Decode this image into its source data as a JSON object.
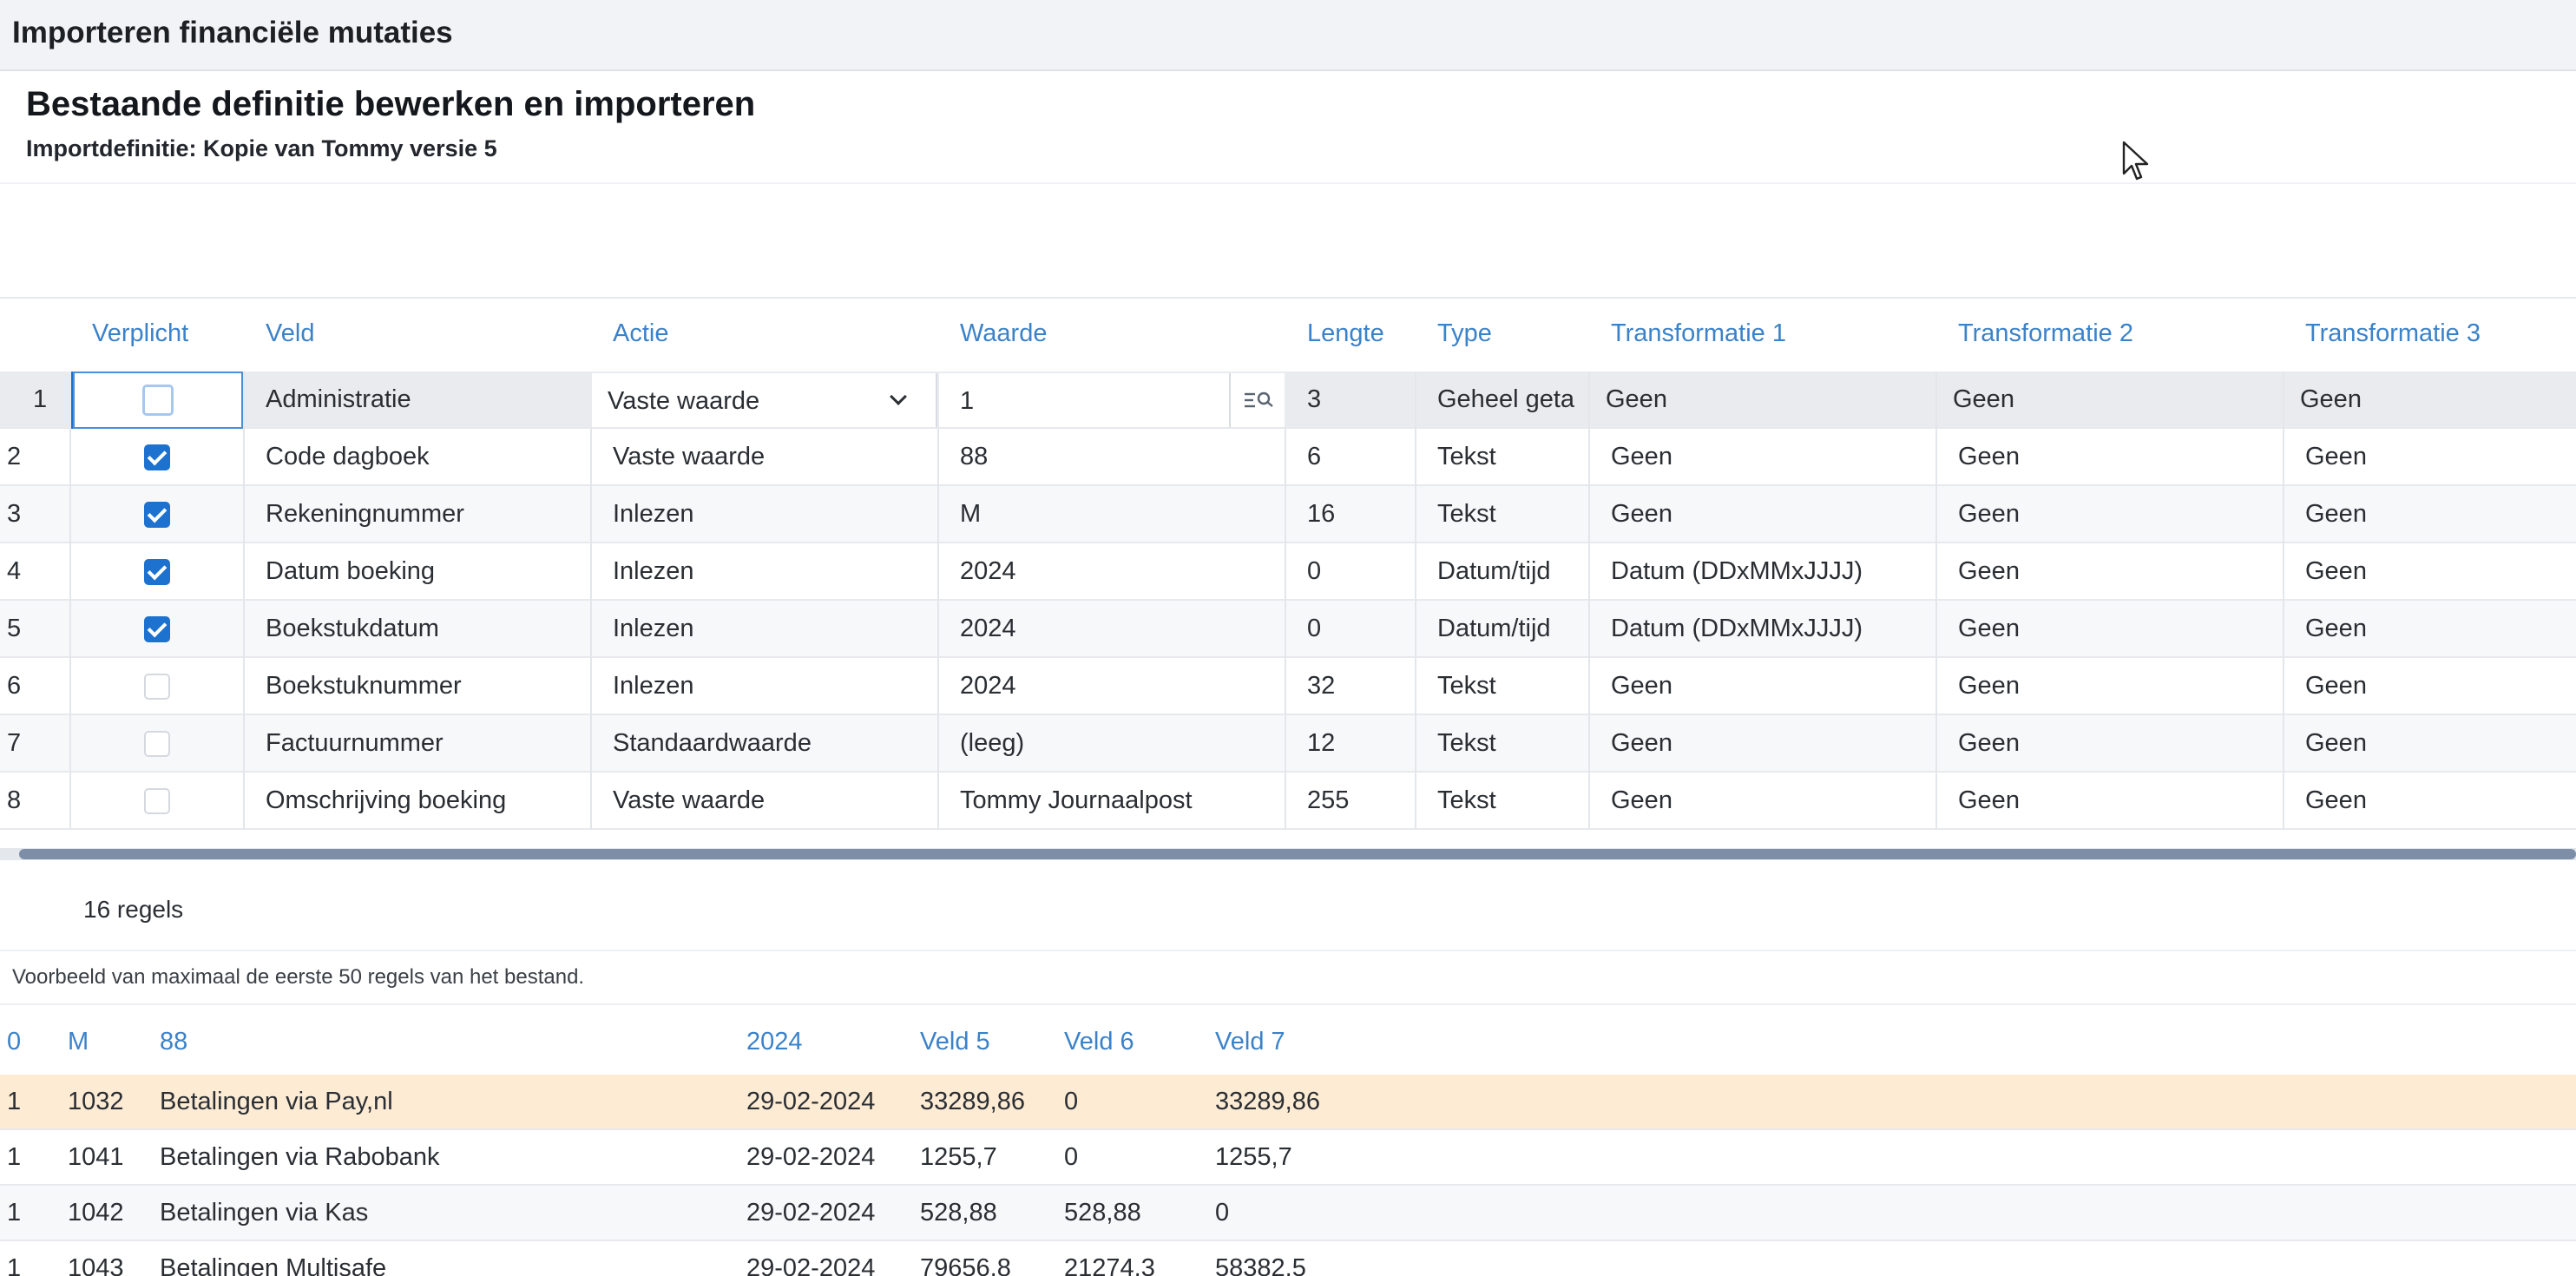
{
  "window": {
    "title": "Importeren financiële mutaties"
  },
  "page": {
    "heading": "Bestaande definitie bewerken en importeren",
    "subheading": "Importdefinitie: Kopie van Tommy versie 5"
  },
  "definition_table": {
    "columns": [
      "Verplicht",
      "Veld",
      "Actie",
      "Waarde",
      "Lengte",
      "Type",
      "Transformatie 1",
      "Transformatie 2",
      "Transformatie 3"
    ],
    "rows": [
      {
        "num": "1",
        "required": false,
        "field": "Administratie",
        "action": "Vaste waarde",
        "value": "1",
        "length": "3",
        "type": "Geheel geta",
        "t1": "Geen",
        "t2": "Geen",
        "t3": "Geen"
      },
      {
        "num": "2",
        "required": true,
        "field": "Code dagboek",
        "action": "Vaste waarde",
        "value": "88",
        "length": "6",
        "type": "Tekst",
        "t1": "Geen",
        "t2": "Geen",
        "t3": "Geen"
      },
      {
        "num": "3",
        "required": true,
        "field": "Rekeningnummer",
        "action": "Inlezen",
        "value": "M",
        "length": "16",
        "type": "Tekst",
        "t1": "Geen",
        "t2": "Geen",
        "t3": "Geen"
      },
      {
        "num": "4",
        "required": true,
        "field": "Datum boeking",
        "action": "Inlezen",
        "value": "2024",
        "length": "0",
        "type": "Datum/tijd",
        "t1": "Datum (DDxMMxJJJJ)",
        "t2": "Geen",
        "t3": "Geen"
      },
      {
        "num": "5",
        "required": true,
        "field": "Boekstukdatum",
        "action": "Inlezen",
        "value": "2024",
        "length": "0",
        "type": "Datum/tijd",
        "t1": "Datum (DDxMMxJJJJ)",
        "t2": "Geen",
        "t3": "Geen"
      },
      {
        "num": "6",
        "required": false,
        "field": "Boekstuknummer",
        "action": "Inlezen",
        "value": "2024",
        "length": "32",
        "type": "Tekst",
        "t1": "Geen",
        "t2": "Geen",
        "t3": "Geen"
      },
      {
        "num": "7",
        "required": false,
        "field": "Factuurnummer",
        "action": "Standaardwaarde",
        "value": "(leeg)",
        "length": "12",
        "type": "Tekst",
        "t1": "Geen",
        "t2": "Geen",
        "t3": "Geen"
      },
      {
        "num": "8",
        "required": false,
        "field": "Omschrijving boeking",
        "action": "Vaste waarde",
        "value": "Tommy Journaalpost",
        "length": "255",
        "type": "Tekst",
        "t1": "Geen",
        "t2": "Geen",
        "t3": "Geen"
      }
    ],
    "row_count": "16 regels"
  },
  "preview": {
    "note": "Voorbeeld van maximaal de eerste 50 regels van het bestand.",
    "columns": [
      "0",
      "M",
      "88",
      "2024",
      "Veld 5",
      "Veld 6",
      "Veld 7"
    ],
    "rows": [
      [
        "1",
        "1032",
        "Betalingen via Pay,nl",
        "29-02-2024",
        "33289,86",
        "0",
        "33289,86"
      ],
      [
        "1",
        "1041",
        "Betalingen via Rabobank",
        "29-02-2024",
        "1255,7",
        "0",
        "1255,7"
      ],
      [
        "1",
        "1042",
        "Betalingen via Kas",
        "29-02-2024",
        "528,88",
        "528,88",
        "0"
      ],
      [
        "1",
        "1043",
        "Betalingen Multisafe",
        "29-02-2024",
        "79656,8",
        "21274,3",
        "58382,5"
      ]
    ]
  },
  "colors": {
    "accent": "#3b82c9",
    "checkbox": "#1d72d0",
    "highlight_row": "#fdebd4"
  },
  "icons": {
    "lookup": "lookup-list-icon",
    "dropdown": "chevron-down-icon",
    "cursor": "mouse-pointer-icon"
  }
}
